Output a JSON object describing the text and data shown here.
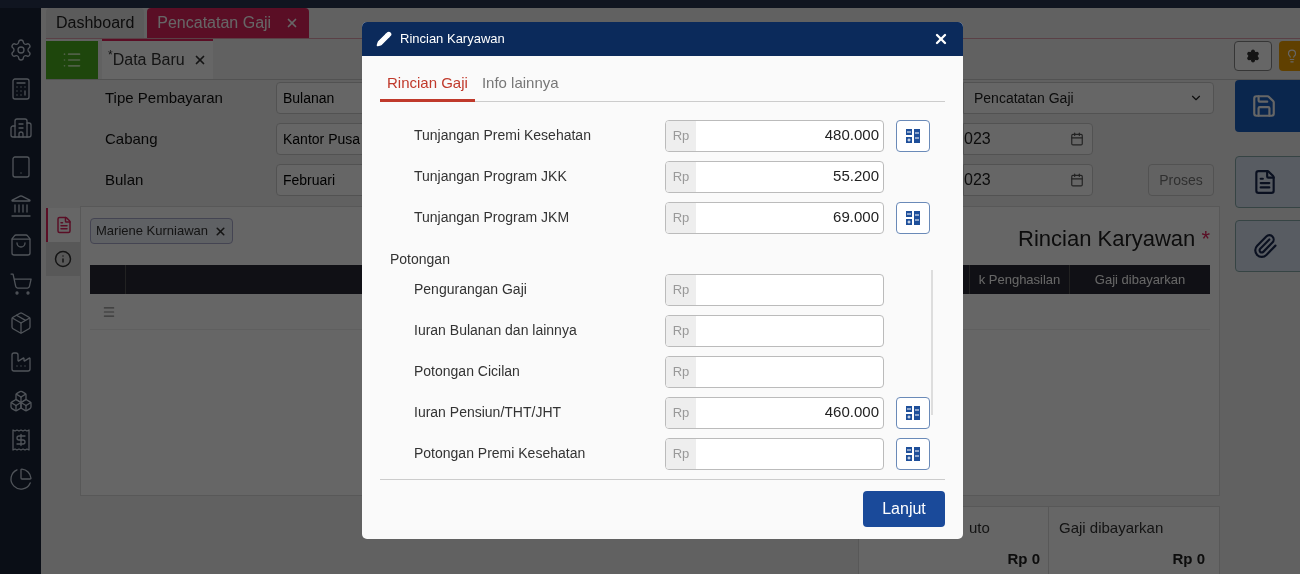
{
  "top_tabs": [
    {
      "label": "Dashboard",
      "selected": false,
      "closable": false
    },
    {
      "label": "Pencatatan Gaji",
      "selected": true,
      "closable": true
    }
  ],
  "sub_tab": {
    "mark": "*",
    "label": "Data Baru",
    "selected": true
  },
  "form": {
    "left": [
      {
        "label": "Tipe Pembayaran",
        "value": "Bulanan"
      },
      {
        "label": "Cabang",
        "value": "Kantor Pusa"
      },
      {
        "label": "Bulan",
        "value": "Februari"
      }
    ],
    "right": [
      {
        "kind": "select",
        "value": "Pencatatan Gaji"
      },
      {
        "kind": "date",
        "value": "023"
      },
      {
        "kind": "date",
        "value": "023"
      }
    ],
    "process_button": {
      "label": "Proses",
      "disabled": true
    }
  },
  "side_tabs": [
    {
      "kind": "document",
      "selected": true
    },
    {
      "kind": "info",
      "selected": false
    }
  ],
  "employee_chip": "Mariene Kurniawan",
  "panel_title": "Rincian Karyawan",
  "required_mark": "*",
  "table": {
    "columns": [
      "k Penghasilan",
      "Gaji dibayarkan"
    ]
  },
  "totals": [
    {
      "label": "uto",
      "value": "Rp 0"
    },
    {
      "label": "Gaji dibayarkan",
      "value": "Rp 0"
    }
  ],
  "modal": {
    "title": "Rincian Karyawan",
    "tabs": [
      {
        "label": "Rincian Gaji",
        "selected": true
      },
      {
        "label": "Info lainnya",
        "selected": false
      }
    ],
    "sections": [
      {
        "items": [
          {
            "label": "Tunjangan Premi Kesehatan",
            "prefix": "Rp",
            "value": "480.000",
            "calculator": true
          },
          {
            "label": "Tunjangan Program JKK",
            "prefix": "Rp",
            "value": "55.200",
            "calculator": false
          },
          {
            "label": "Tunjangan Program JKM",
            "prefix": "Rp",
            "value": "69.000",
            "calculator": true
          }
        ]
      },
      {
        "heading": "Potongan",
        "items": [
          {
            "label": "Pengurangan Gaji",
            "prefix": "Rp",
            "calculator": false
          },
          {
            "label": "Iuran Bulanan dan lainnya",
            "prefix": "Rp",
            "calculator": false
          },
          {
            "label": "Potongan Cicilan",
            "prefix": "Rp",
            "calculator": false
          },
          {
            "label": "Iuran Pensiun/THT/JHT",
            "prefix": "Rp",
            "value": "460.000",
            "calculator": true
          },
          {
            "label": "Potongan Premi Kesehatan",
            "prefix": "Rp",
            "calculator": true
          }
        ]
      }
    ],
    "continue_button": "Lanjut"
  }
}
